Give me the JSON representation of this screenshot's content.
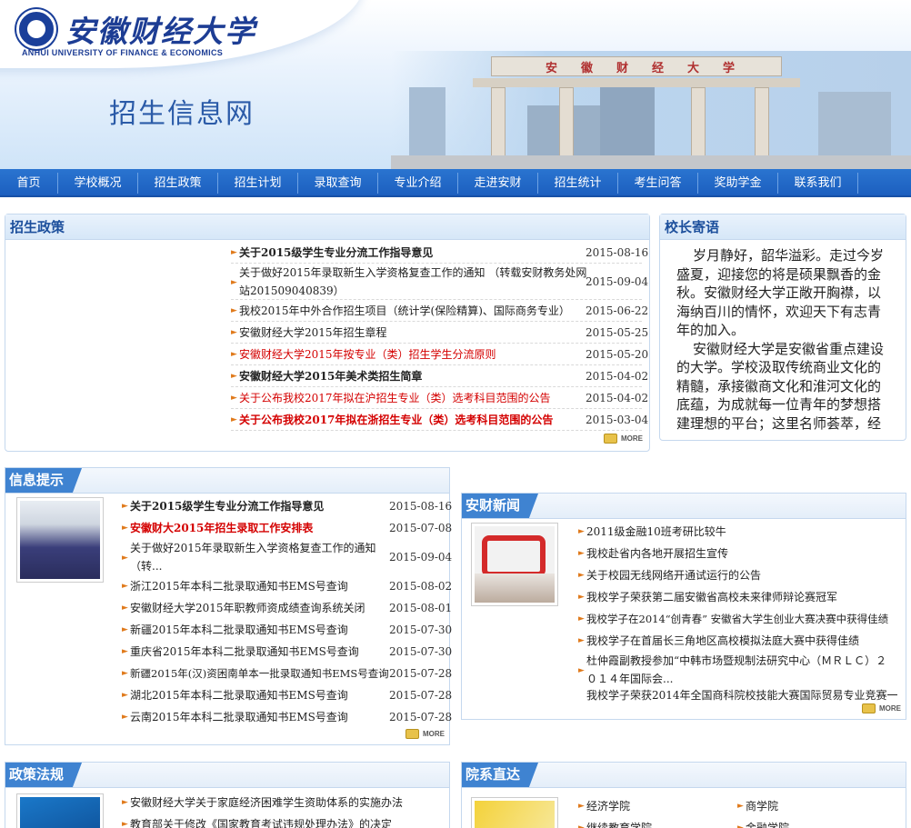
{
  "header": {
    "logo_cn": "安徽财经大学",
    "logo_en": "ANHUI UNIVERSITY OF FINANCE & ECONOMICS",
    "site_title": "招生信息网",
    "gate_text": "安徽财经大学"
  },
  "nav": [
    "首页",
    "学校概况",
    "招生政策",
    "招生计划",
    "录取查询",
    "专业介绍",
    "走进安财",
    "招生统计",
    "考生问答",
    "奖助学金",
    "联系我们"
  ],
  "zszc": {
    "title": "招生政策",
    "more": "MORE",
    "items": [
      {
        "text": "关于2015级学生专业分流工作指导意见",
        "date": "2015-08-16",
        "style": "bold"
      },
      {
        "text": "关于做好2015年录取新生入学资格复查工作的通知 （转载安财教务处网",
        "text2": "站201509040839）",
        "date": "2015-09-04",
        "style": "normal"
      },
      {
        "text": "我校2015年中外合作招生项目（统计学(保险精算)、国际商务专业）",
        "date": "2015-06-22",
        "style": "normal"
      },
      {
        "text": "安徽财经大学2015年招生章程",
        "date": "2015-05-25",
        "style": "normal"
      },
      {
        "text": "安徽财经大学2015年按专业（类）招生学生分流原则",
        "date": "2015-05-20",
        "style": "red"
      },
      {
        "text": "安徽财经大学2015年美术类招生简章",
        "date": "2015-04-02",
        "style": "bold"
      },
      {
        "text": "关于公布我校2017年拟在沪招生专业（类）选考科目范围的公告",
        "date": "2015-04-02",
        "style": "red"
      },
      {
        "text": "关于公布我校2017年拟在浙招生专业（类）选考科目范围的公告",
        "date": "2015-03-04",
        "style": "redbold"
      }
    ]
  },
  "xzjy": {
    "title": "校长寄语",
    "lines": [
      "岁月静好，韶华溢彩。走过今岁",
      "盛夏，迎接您的将是硕果飘香的金",
      "秋。安徽财经大学正敞开胸襟，以",
      "海纳百川的情怀，欢迎天下有志青",
      "年的加入。",
      "安徽财经大学是安徽省重点建设",
      "的大学。学校汲取传统商业文化的",
      "精髓，承接徽商文化和淮河文化的",
      "底蕴，为成就每一位青年的梦想搭",
      "建理想的平台；这里名师荟萃，经"
    ]
  },
  "xxts": {
    "title": "信息提示",
    "more": "MORE",
    "items": [
      {
        "text": "关于2015级学生专业分流工作指导意见",
        "date": "2015-08-16",
        "style": "bold"
      },
      {
        "text": "安徽财大2015年招生录取工作安排表",
        "date": "2015-07-08",
        "style": "redbold"
      },
      {
        "text": "关于做好2015年录取新生入学资格复查工作的通知",
        "text2": "（转...",
        "date": "2015-09-04",
        "style": "normal"
      },
      {
        "text": "浙江2015年本科二批录取通知书EMS号查询",
        "date": "2015-08-02",
        "style": "normal"
      },
      {
        "text": "安徽财经大学2015年职教师资成绩查询系统关闭",
        "date": "2015-08-01",
        "style": "normal"
      },
      {
        "text": "新疆2015年本科二批录取通知书EMS号查询",
        "date": "2015-07-30",
        "style": "normal"
      },
      {
        "text": "重庆省2015年本科二批录取通知书EMS号查询",
        "date": "2015-07-30",
        "style": "normal"
      },
      {
        "text": "新疆2015年(汉)资困南单本一批录取通知书EMS号查询",
        "date": "2015-07-28",
        "style": "normal"
      },
      {
        "text": "湖北2015年本科二批录取通知书EMS号查询",
        "date": "2015-07-28",
        "style": "normal"
      },
      {
        "text": "云南2015年本科二批录取通知书EMS号查询",
        "date": "2015-07-28",
        "style": "normal"
      }
    ]
  },
  "acxw": {
    "title": "安财新闻",
    "more": "MORE",
    "items": [
      {
        "text": "2011级金融10班考研比较牛"
      },
      {
        "text": "我校赴省内各地开展招生宣传"
      },
      {
        "text": "关于校园无线网络开通试运行的公告"
      },
      {
        "text": "我校学子荣获第二届安徽省高校未来律师辩论赛冠军"
      },
      {
        "text": "我校学子在2014“创青春” 安徽省大学生创业大赛决赛中获得佳绩"
      },
      {
        "text": "我校学子在首届长三角地区高校模拟法庭大赛中获得佳绩"
      },
      {
        "text": "杜仲霞副教授参加“中韩市场暨规制法研究中心（ＭＲＬＣ）２",
        "text2": "０１４年国际会..."
      },
      {
        "text": "我校学子荣获2014年全国商科院校技能大赛国际贸易专业竞赛一"
      }
    ]
  },
  "zcfg": {
    "title": "政策法规",
    "items": [
      {
        "text": "安徽财经大学关于家庭经济困难学生资助体系的实施办法"
      },
      {
        "text": "教育部关于修改《国家教育考试违规处理办法》的决定"
      }
    ]
  },
  "yxzd": {
    "title": "院系直达",
    "items": [
      {
        "text": "经济学院"
      },
      {
        "text": "商学院"
      },
      {
        "text": "继续教育学院"
      },
      {
        "text": "金融学院"
      }
    ]
  },
  "colors": {
    "nav": "#1c5fbf",
    "title": "#1c4f9c",
    "red": "#d40000",
    "arrow": "#e07a1c"
  }
}
